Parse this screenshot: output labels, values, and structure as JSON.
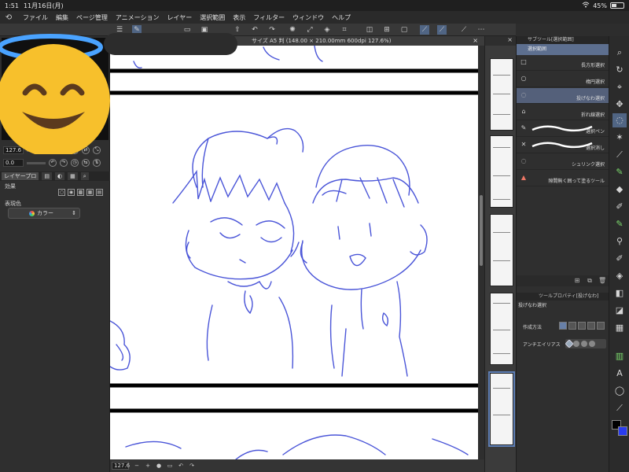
{
  "status": {
    "time": "1:51",
    "date": "11月16日(月)",
    "battery": "45%",
    "battery_level": 0.45
  },
  "menu": {
    "items": [
      "ファイル",
      "編集",
      "ページ管理",
      "アニメーション",
      "レイヤー",
      "選択範囲",
      "表示",
      "フィルター",
      "ウィンドウ",
      "ヘルプ"
    ]
  },
  "document": {
    "title": "サイズ A5 判 (148.00 × 210.00mm 600dpi 127.6%)",
    "close_label": "×"
  },
  "left_panel": {
    "zoom_value": "127.6",
    "angle_value": "0.0",
    "tabs": [
      "レイヤープロ"
    ],
    "effect_label": "効果",
    "expression_label": "表現色",
    "expression_value": "カラー"
  },
  "bottom_bar": {
    "zoom_value": "127.6"
  },
  "subtool": {
    "header": "サブツール[選択範囲]",
    "group": "選択範囲",
    "items": [
      {
        "name": "長方形選択",
        "icon": "rect-icon"
      },
      {
        "name": "楕円選択",
        "icon": "ellipse-icon"
      },
      {
        "name": "投げなわ選択",
        "icon": "lasso-icon"
      },
      {
        "name": "折れ線選択",
        "icon": "polyline-icon"
      },
      {
        "name": "選択ペン",
        "icon": "pen-icon"
      },
      {
        "name": "選択消し",
        "icon": "eraser-icon"
      },
      {
        "name": "シュリンク選択",
        "icon": "lasso-icon"
      },
      {
        "name": "隙間無く囲って塗るツール",
        "icon": "fill-icon"
      }
    ]
  },
  "tool_property": {
    "header": "ツールプロパティ[投げなわ]",
    "title": "投げなわ選択",
    "creation_method_label": "作成方法",
    "antialias_label": "アンチエイリアス"
  },
  "colors": {
    "accent": "#506584",
    "selected_row": "#54607a",
    "sketch_line": "#4a55d8",
    "background_color": "#2a3cf0"
  }
}
